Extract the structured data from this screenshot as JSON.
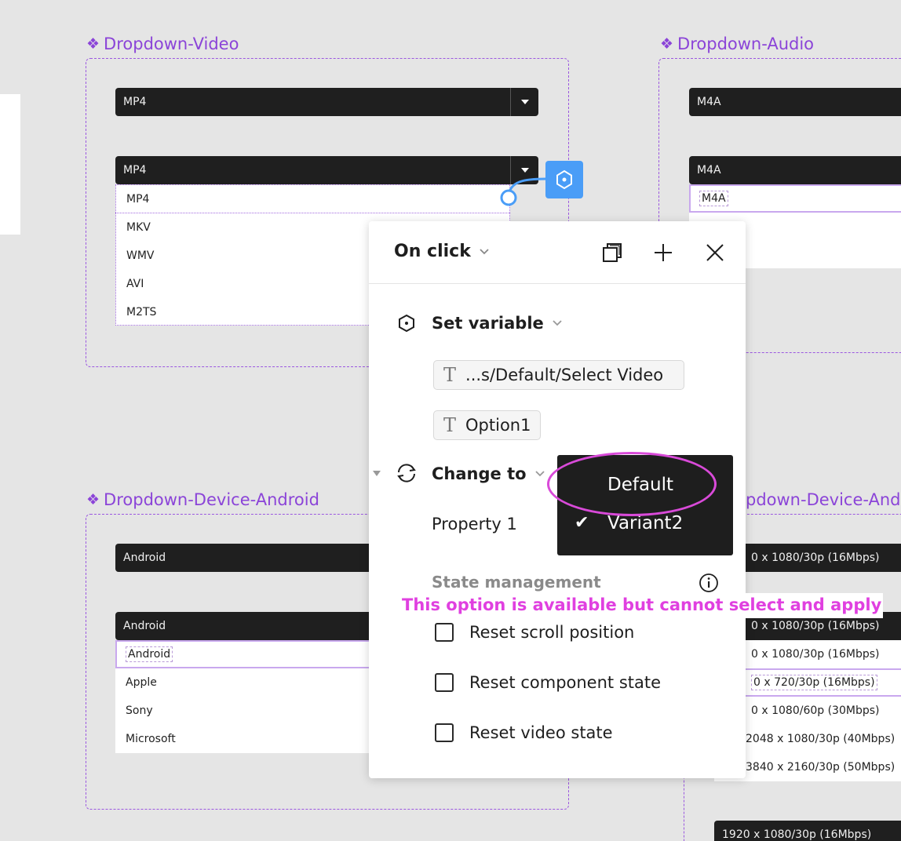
{
  "canvas": {
    "components": {
      "video": {
        "title": "Dropdown-Video",
        "closed_value": "MP4",
        "open_value": "MP4",
        "options": [
          "MP4",
          "MKV",
          "WMV",
          "AVI",
          "M2TS"
        ]
      },
      "audio": {
        "title": "Dropdown-Audio",
        "closed_value": "M4A",
        "open_value": "M4A",
        "options": [
          "M4A"
        ]
      },
      "android": {
        "title": "Dropdown-Device-Android",
        "closed_value": "Android",
        "open_value": "Android",
        "options": [
          "Android",
          "Apple",
          "Sony",
          "Microsoft"
        ]
      },
      "android2": {
        "title": "pdown-Device-Andr",
        "closed_value": "0 x 1080/30p (16Mbps)",
        "open_value": "0 x 1080/30p (16Mbps)",
        "options": [
          "0 x 1080/30p (16Mbps)",
          "0 x 720/30p (16Mbps)",
          "0 x 1080/60p (30Mbps)",
          "2048 x 1080/30p (40Mbps)",
          "3840 x 2160/30p (50Mbps)"
        ],
        "bottom_value": "1920 x 1080/30p (16Mbps)"
      }
    }
  },
  "interaction_panel": {
    "trigger": "On click",
    "actions": {
      "set_variable": {
        "label": "Set variable",
        "variable": "...s/Default/Select Video",
        "value": "Option1"
      },
      "change_to": {
        "label": "Change to",
        "property_label": "Property 1",
        "options": [
          {
            "label": "Default",
            "selected": false
          },
          {
            "label": "Variant2",
            "selected": true,
            "check": "✔"
          }
        ]
      }
    },
    "state_management": {
      "label": "State management",
      "options": [
        {
          "label": "Reset scroll position",
          "checked": false
        },
        {
          "label": "Reset component state",
          "checked": false
        },
        {
          "label": "Reset video state",
          "checked": false
        }
      ]
    }
  },
  "annotation": {
    "text": "This option is available but cannot select and apply",
    "color": "#e040e0"
  },
  "colors": {
    "component_purple": "#8b44d8",
    "prototype_blue": "#4a9df7",
    "dropdown_dark": "#1f1f1f"
  }
}
